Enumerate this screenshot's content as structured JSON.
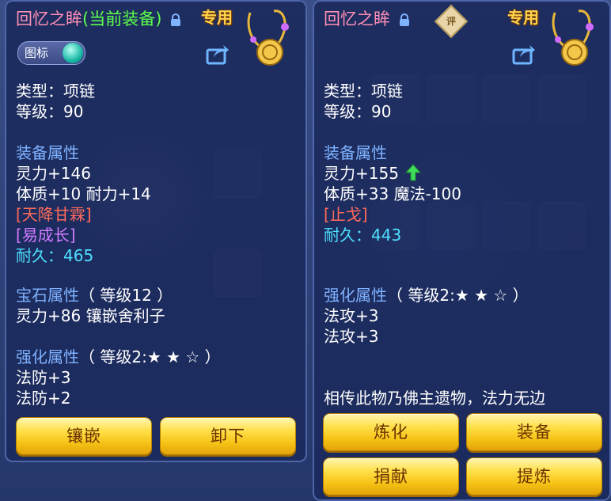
{
  "left_panel": {
    "title_name": "回忆之眸",
    "title_status": "(当前装备)",
    "exclusive_tag": "专用",
    "icon_toggle_label": "图标",
    "type_line": "类型：项链",
    "level_line": "等级：90",
    "equip_attr_header": "装备属性",
    "attr_1": "灵力+146",
    "attr_2": "体质+10 耐力+14",
    "special_1": "[天降甘霖]",
    "special_2": "[易成长]",
    "durability_label": "耐久：",
    "durability_value": "465",
    "gem_header": "宝石属性",
    "gem_level": "（ 等级12 ）",
    "gem_attr": "灵力+86 镶嵌舍利子",
    "enhance_header": "强化属性",
    "enhance_level": "（ 等级2:★ ★ ☆ ）",
    "enhance_1": "法防+3",
    "enhance_2": "法防+2",
    "buttons": {
      "inlay": "镶嵌",
      "unequip": "卸下"
    }
  },
  "right_panel": {
    "title_name": "回忆之眸",
    "appraise_badge": "评",
    "exclusive_tag": "专用",
    "type_line": "类型：项链",
    "level_line": "等级：90",
    "equip_attr_header": "装备属性",
    "attr_1": "灵力+155",
    "attr_2": "体质+33 魔法-100",
    "special_1": "[止戈]",
    "durability_label": "耐久：",
    "durability_value": "443",
    "enhance_header": "强化属性",
    "enhance_level": "（ 等级2:★ ★ ☆ ）",
    "enhance_1": "法攻+3",
    "enhance_2": "法攻+3",
    "description": "相传此物乃佛主遗物，法力无边",
    "buttons": {
      "refine": "炼化",
      "equip": "装备",
      "donate": "捐献",
      "extract": "提炼"
    }
  },
  "colors": {
    "title_pink": "#ff8fb5",
    "equipped_green": "#5cff4a",
    "section_blue": "#7fb2ff",
    "special_red": "#ff6a5a",
    "special_purple": "#d07bff",
    "durability_cyan": "#4ee0ff",
    "button_gold": "#f6c215"
  }
}
